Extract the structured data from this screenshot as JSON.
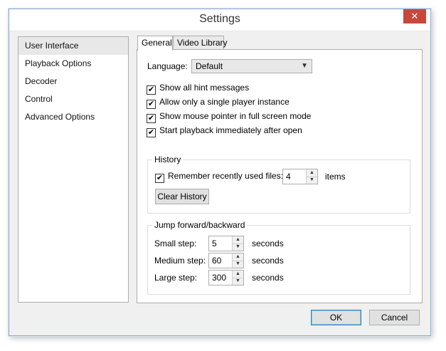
{
  "window": {
    "title": "Settings",
    "close_glyph": "✕"
  },
  "sidebar": {
    "items": [
      {
        "label": "User Interface"
      },
      {
        "label": "Playback Options"
      },
      {
        "label": "Decoder"
      },
      {
        "label": "Control"
      },
      {
        "label": "Advanced Options"
      }
    ],
    "selected": "User Interface"
  },
  "tabs": [
    {
      "label": "General"
    },
    {
      "label": "Video Library"
    }
  ],
  "general": {
    "language_label": "Language:",
    "language_value": "Default",
    "checkboxes": [
      {
        "label": "Show all hint messages",
        "checked": true
      },
      {
        "label": "Allow only a single player instance",
        "checked": true
      },
      {
        "label": "Show mouse pointer in full screen mode",
        "checked": true
      },
      {
        "label": "Start playback immediately after open",
        "checked": true
      }
    ],
    "history": {
      "title": "History",
      "remember_label": "Remember recently used files:",
      "remember_checked": true,
      "count": "4",
      "unit": "items",
      "clear_button": "Clear History"
    },
    "jump": {
      "title": "Jump forward/backward",
      "rows": [
        {
          "label": "Small step:",
          "value": "5",
          "unit": "seconds"
        },
        {
          "label": "Medium step:",
          "value": "60",
          "unit": "seconds"
        },
        {
          "label": "Large step:",
          "value": "300",
          "unit": "seconds"
        }
      ]
    }
  },
  "footer": {
    "ok": "OK",
    "cancel": "Cancel"
  },
  "icons": {
    "check": "✔",
    "dropdown_arrow": "▼",
    "spin_up": "▲",
    "spin_down": "▼"
  }
}
